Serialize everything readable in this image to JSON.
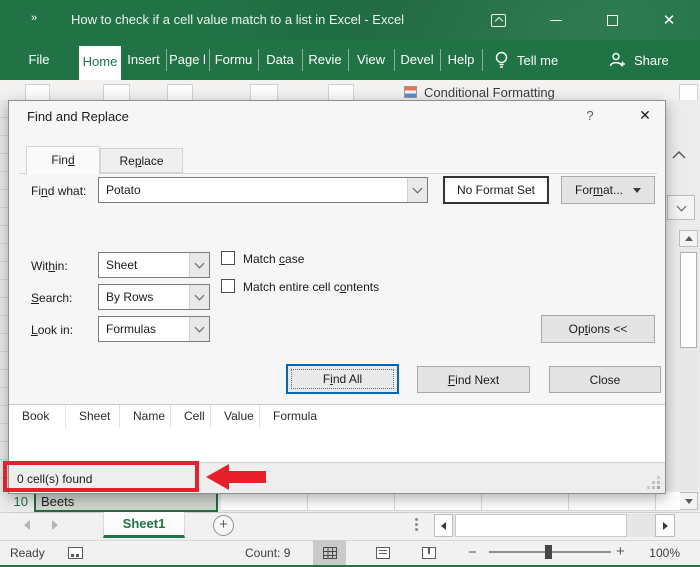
{
  "colors": {
    "excel_green": "#217346",
    "annotation_red": "#e8202c",
    "focus_blue": "#0067b8",
    "dialog_bg": "#f6f6f6"
  },
  "window": {
    "title": "How to check if a cell value match to a list in Excel - Excel",
    "qat_glyph": "»",
    "close_glyph": "✕"
  },
  "ribbon": {
    "tabs": [
      {
        "label": "File"
      },
      {
        "label": "Home"
      },
      {
        "label": "Insert"
      },
      {
        "label": "Page l"
      },
      {
        "label": "Formu"
      },
      {
        "label": "Data"
      },
      {
        "label": "Revie"
      },
      {
        "label": "View"
      },
      {
        "label": "Devel"
      },
      {
        "label": "Help"
      }
    ],
    "tell_me": "Tell me",
    "share": "Share",
    "conditional_formatting": "Conditional Formatting"
  },
  "dialog": {
    "title": "Find and Replace",
    "help_glyph": "?",
    "close_glyph": "✕",
    "tab_find": {
      "pre": "Fin",
      "acc": "d",
      "post": ""
    },
    "tab_replace": {
      "pre": "Re",
      "acc": "p",
      "post": "lace"
    },
    "find_what_label": {
      "pre": "Fi",
      "acc": "n",
      "post": "d what:"
    },
    "find_what_value": "Potato",
    "no_format": "No Format Set",
    "format_button": {
      "pre": "For",
      "acc": "m",
      "post": "at..."
    },
    "within_label": {
      "pre": "Wit",
      "acc": "h",
      "post": "in:"
    },
    "within_value": "Sheet",
    "search_label": {
      "pre": "",
      "acc": "S",
      "post": "earch:"
    },
    "search_value": "By Rows",
    "look_in_label": {
      "pre": "",
      "acc": "L",
      "post": "ook in:"
    },
    "look_in_value": "Formulas",
    "match_case": {
      "pre": "Match ",
      "acc": "c",
      "post": "ase"
    },
    "match_entire": {
      "pre": "Match entire cell c",
      "acc": "o",
      "post": "ntents"
    },
    "options_button": {
      "pre": "Op",
      "acc": "t",
      "post": "ions <<"
    },
    "find_all": {
      "pre": "F",
      "acc": "i",
      "post": "nd All"
    },
    "find_next": {
      "pre": "",
      "acc": "F",
      "post": "ind Next"
    },
    "close_button": "Close",
    "result_columns": [
      {
        "label": "Book"
      },
      {
        "label": "Sheet"
      },
      {
        "label": "Name"
      },
      {
        "label": "Cell"
      },
      {
        "label": "Value"
      },
      {
        "label": "Formula"
      }
    ],
    "status_text": "0 cell(s) found"
  },
  "sheet": {
    "row_number": "10",
    "cell_value": "Beets",
    "tab_name": "Sheet1",
    "add_glyph": "+"
  },
  "status_bar": {
    "ready": "Ready",
    "count": "Count: 9",
    "zoom_out": "−",
    "zoom_in": "+",
    "zoom_pct": "100%"
  }
}
